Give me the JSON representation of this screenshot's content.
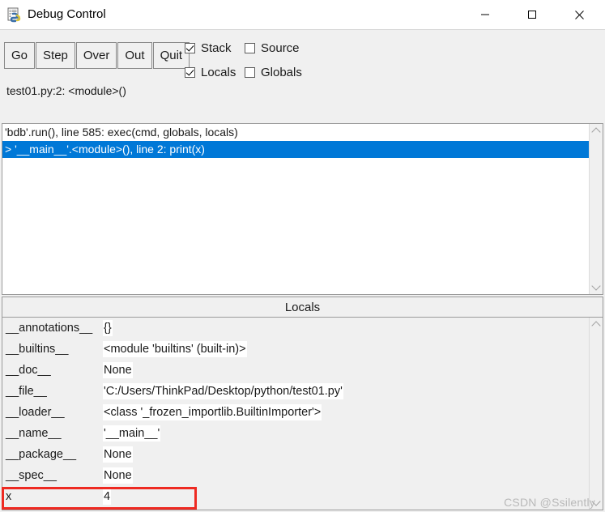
{
  "window": {
    "title": "Debug Control",
    "icon": "python-idle-icon",
    "controls": {
      "minimize": "minimize-icon",
      "maximize": "maximize-icon",
      "close": "close-icon"
    }
  },
  "toolbar": {
    "buttons": [
      {
        "label": "Go"
      },
      {
        "label": "Step"
      },
      {
        "label": "Over"
      },
      {
        "label": "Out"
      },
      {
        "label": "Quit"
      }
    ],
    "checkboxes": [
      {
        "label": "Stack",
        "checked": true
      },
      {
        "label": "Source",
        "checked": false
      },
      {
        "label": "Locals",
        "checked": true
      },
      {
        "label": "Globals",
        "checked": false
      }
    ]
  },
  "status": {
    "location": "test01.py:2: <module>()"
  },
  "stack": {
    "rows": [
      {
        "text": "'bdb'.run(), line 585: exec(cmd, globals, locals)",
        "selected": false
      },
      {
        "text": "> '__main__'.<module>(), line 2: print(x)",
        "selected": true
      }
    ],
    "selection_color": "#0078d7"
  },
  "locals": {
    "header": "Locals",
    "rows": [
      {
        "name": "__annotations__",
        "value": "{}"
      },
      {
        "name": "__builtins__",
        "value": "<module 'builtins' (built-in)>"
      },
      {
        "name": "__doc__",
        "value": "None"
      },
      {
        "name": "__file__",
        "value": "'C:/Users/ThinkPad/Desktop/python/test01.py'"
      },
      {
        "name": "__loader__",
        "value": "<class '_frozen_importlib.BuiltinImporter'>"
      },
      {
        "name": "__name__",
        "value": "'__main__'"
      },
      {
        "name": "__package__",
        "value": "None"
      },
      {
        "name": "__spec__",
        "value": "None"
      },
      {
        "name": "x",
        "value": "4"
      }
    ]
  },
  "annotation": {
    "highlight_color": "#ee2a22",
    "highlighted_row": "x"
  },
  "watermark": {
    "text": "CSDN @Ssilently"
  }
}
